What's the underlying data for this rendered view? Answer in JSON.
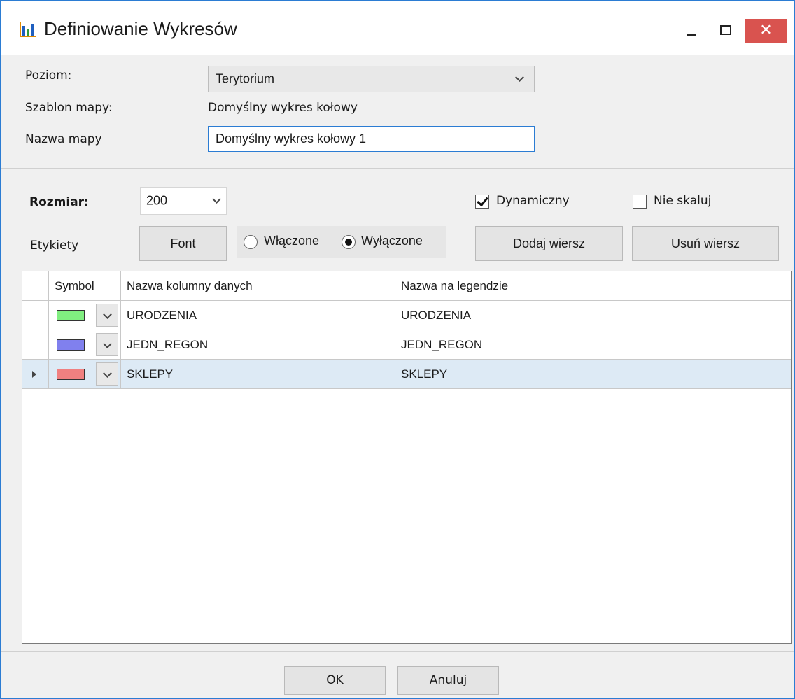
{
  "window": {
    "title": "Definiowanie Wykresów",
    "icon": "bar-chart-icon",
    "close_glyph": "✕"
  },
  "form": {
    "poziom_label": "Poziom:",
    "poziom_value": "Terytorium",
    "szablon_label": "Szablon mapy:",
    "szablon_value": "Domyślny wykres kołowy",
    "nazwa_label": "Nazwa mapy",
    "nazwa_value": "Domyślny wykres kołowy 1"
  },
  "options": {
    "rozmiar_label": "Rozmiar:",
    "rozmiar_value": "200",
    "dynamiczny_label": "Dynamiczny",
    "dynamiczny_checked": true,
    "nieskaluj_label": "Nie skaluj",
    "nieskaluj_checked": false,
    "etykiety_label": "Etykiety",
    "font_button": "Font",
    "wlaczone_label": "Włączone",
    "wylaczone_label": "Wyłączone",
    "selected_radio": "Wyłączone",
    "add_row_button": "Dodaj wiersz",
    "remove_row_button": "Usuń wiersz"
  },
  "grid": {
    "columns": [
      "Symbol",
      "Nazwa kolumny danych",
      "Nazwa na legendzie"
    ],
    "rows": [
      {
        "color": "#80ee80",
        "data_column": "URODZENIA",
        "legend": "URODZENIA",
        "selected": false
      },
      {
        "color": "#8080ee",
        "data_column": "JEDN_REGON",
        "legend": "JEDN_REGON",
        "selected": false
      },
      {
        "color": "#f08080",
        "data_column": "SKLEPY",
        "legend": "SKLEPY",
        "selected": true
      }
    ]
  },
  "footer": {
    "ok_button": "OK",
    "cancel_button": "Anuluj"
  }
}
